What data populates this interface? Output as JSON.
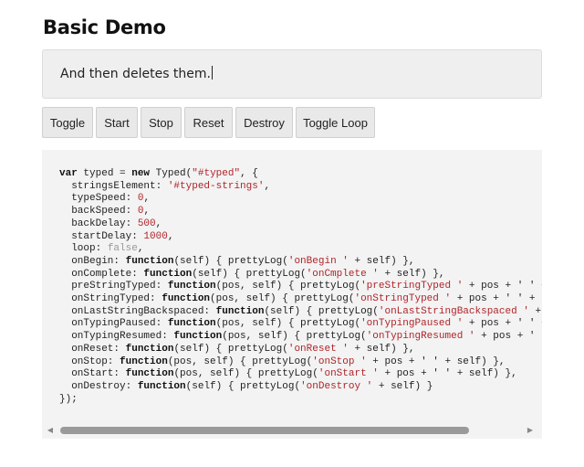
{
  "title": "Basic Demo",
  "typed_text": "And then deletes them.",
  "buttons": [
    "Toggle",
    "Start",
    "Stop",
    "Reset",
    "Destroy",
    "Toggle Loop"
  ],
  "code": {
    "l1": {
      "kw": "var",
      "a": " typed = ",
      "kw2": "new",
      "b": " Typed(",
      "str": "\"#typed\"",
      "c": ", {"
    },
    "l2": {
      "a": "  stringsElement: ",
      "str": "'#typed-strings'",
      "b": ","
    },
    "l3": {
      "a": "  typeSpeed: ",
      "num": "0",
      "b": ","
    },
    "l4": {
      "a": "  backSpeed: ",
      "num": "0",
      "b": ","
    },
    "l5": {
      "a": "  backDelay: ",
      "num": "500",
      "b": ","
    },
    "l6": {
      "a": "  startDelay: ",
      "num": "1000",
      "b": ","
    },
    "l7": {
      "a": "  loop: ",
      "lit": "false",
      "b": ","
    },
    "l8": {
      "a": "  onBegin: ",
      "kw": "function",
      "b": "(self) { prettyLog(",
      "str": "'onBegin '",
      "c": " + self) },"
    },
    "l9": {
      "a": "  onComplete: ",
      "kw": "function",
      "b": "(self) { prettyLog(",
      "str": "'onCmplete '",
      "c": " + self) },"
    },
    "l10": {
      "a": "  preStringTyped: ",
      "kw": "function",
      "b": "(pos, self) { prettyLog(",
      "str": "'preStringTyped '",
      "c": " + pos + ' ' +"
    },
    "l11": {
      "a": "  onStringTyped: ",
      "kw": "function",
      "b": "(pos, self) { prettyLog(",
      "str": "'onStringTyped '",
      "c": " + pos + ' ' + se"
    },
    "l12": {
      "a": "  onLastStringBackspaced: ",
      "kw": "function",
      "b": "(self) { prettyLog(",
      "str": "'onLastStringBackspaced '",
      "c": " + s"
    },
    "l13": {
      "a": "  onTypingPaused: ",
      "kw": "function",
      "b": "(pos, self) { prettyLog(",
      "str": "'onTypingPaused '",
      "c": " + pos + ' ' +"
    },
    "l14": {
      "a": "  onTypingResumed: ",
      "kw": "function",
      "b": "(pos, self) { prettyLog(",
      "str": "'onTypingResumed '",
      "c": " + pos + ' '"
    },
    "l15": {
      "a": "  onReset: ",
      "kw": "function",
      "b": "(self) { prettyLog(",
      "str": "'onReset '",
      "c": " + self) },"
    },
    "l16": {
      "a": "  onStop: ",
      "kw": "function",
      "b": "(pos, self) { prettyLog(",
      "str": "'onStop '",
      "c": " + pos + ' ' + self) },"
    },
    "l17": {
      "a": "  onStart: ",
      "kw": "function",
      "b": "(pos, self) { prettyLog(",
      "str": "'onStart '",
      "c": " + pos + ' ' + self) },"
    },
    "l18": {
      "a": "  onDestroy: ",
      "kw": "function",
      "b": "(self) { prettyLog(",
      "str": "'onDestroy '",
      "c": " + self) }"
    },
    "l19": {
      "a": "});"
    }
  },
  "colors": {
    "string": "#b0242a",
    "panel_bg": "#f3f3f3",
    "typed_bg": "#efefef"
  }
}
